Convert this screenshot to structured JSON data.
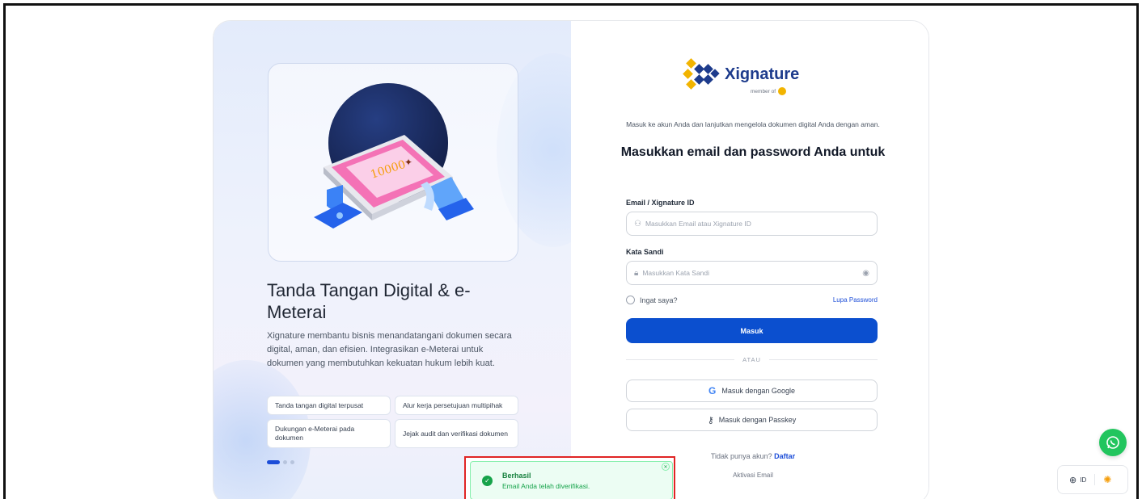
{
  "brand": {
    "name": "Xignature",
    "member_of": "member of"
  },
  "hero": {
    "title": "Tanda Tangan Digital & e-Meterai",
    "description": "Xignature membantu bisnis menandatangani dokumen secara digital, aman, dan efisien. Integrasikan e-Meterai untuk dokumen yang membutuhkan kekuatan hukum lebih kuat.",
    "features": [
      "Tanda tangan digital terpusat",
      "Alur kerja persetujuan multipihak",
      "Dukungan e-Meterai pada dokumen",
      "Jejak audit dan verifikasi dokumen"
    ],
    "slide_count": 3,
    "active_slide": 1,
    "stamp_value": "10000"
  },
  "login": {
    "intro": "Masuk ke akun Anda dan lanjutkan mengelola dokumen digital Anda dengan aman.",
    "heading": "Masukkan email dan password Anda untuk",
    "email_label": "Email / Xignature ID",
    "email_placeholder": "Masukkan Email atau Xignature ID",
    "password_label": "Kata Sandi",
    "password_placeholder": "Masukkan Kata Sandi",
    "remember_label": "Ingat saya?",
    "forgot_label": "Lupa Password",
    "submit_label": "Masuk",
    "divider_label": "ATAU",
    "google_label": "Masuk dengan Google",
    "passkey_label": "Masuk dengan Passkey",
    "no_account": "Tidak punya akun?",
    "signup_label": "Daftar",
    "activation_label": "Aktivasi Email"
  },
  "toast": {
    "title": "Berhasil",
    "message": "Email Anda telah diverifikasi."
  },
  "language": {
    "code": "ID"
  },
  "colors": {
    "primary": "#0b4fcf",
    "brand_navy": "#1d3b8c",
    "brand_gold": "#f2b400",
    "success": "#16a34a",
    "highlight": "#e02424",
    "whatsapp": "#22c55e"
  }
}
